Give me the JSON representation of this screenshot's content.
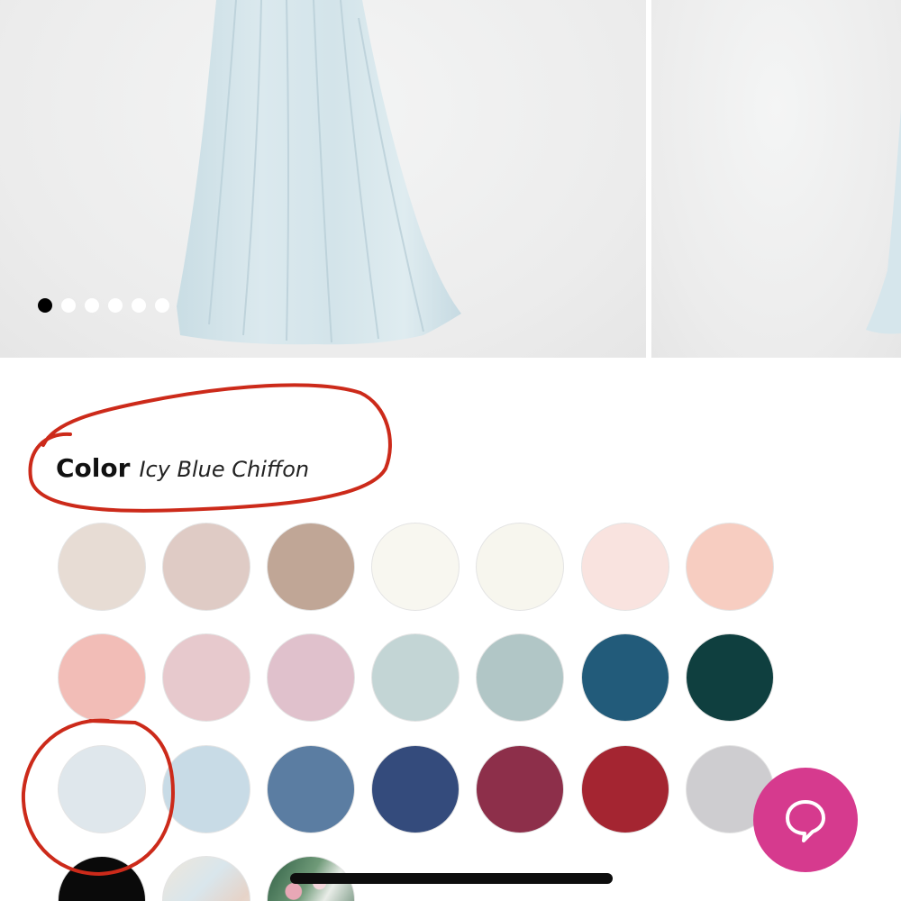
{
  "gallery": {
    "dots_total": 6,
    "active_index": 0
  },
  "color": {
    "label": "Color",
    "selected": "Icy Blue Chiffon"
  },
  "swatches": [
    {
      "name": "swatch-1",
      "color": "#e7dcd4"
    },
    {
      "name": "swatch-2",
      "color": "#dfcbc5"
    },
    {
      "name": "swatch-3",
      "color": "#c0a696"
    },
    {
      "name": "swatch-4",
      "color": "#f8f7f0"
    },
    {
      "name": "swatch-5",
      "color": "#f7f6ee"
    },
    {
      "name": "swatch-6",
      "color": "#f9e3df"
    },
    {
      "name": "swatch-7",
      "color": "#f7cdc1"
    },
    {
      "name": "swatch-8",
      "color": "#f2bdb7"
    },
    {
      "name": "swatch-9",
      "color": "#e7c9cd"
    },
    {
      "name": "swatch-10",
      "color": "#e0c1cc"
    },
    {
      "name": "swatch-11",
      "color": "#c3d5d5"
    },
    {
      "name": "swatch-12",
      "color": "#b1c6c6"
    },
    {
      "name": "swatch-13",
      "color": "#225b7a"
    },
    {
      "name": "swatch-14",
      "color": "#0f3f3f"
    },
    {
      "name": "swatch-icy-blue",
      "color": "#dfe7ec"
    },
    {
      "name": "swatch-16",
      "color": "#c8dbe6"
    },
    {
      "name": "swatch-17",
      "color": "#5b7da2"
    },
    {
      "name": "swatch-18",
      "color": "#344b7c"
    },
    {
      "name": "swatch-19",
      "color": "#8d2f4a"
    },
    {
      "name": "swatch-20",
      "color": "#a42531"
    },
    {
      "name": "swatch-21",
      "color": "#cecdd0"
    },
    {
      "name": "swatch-22",
      "color": "#0a0a0a"
    },
    {
      "name": "swatch-23-print",
      "color": "#e5ddd1"
    },
    {
      "name": "swatch-24-print",
      "color": "#3f6b4f"
    }
  ],
  "annotation_color": "#cc2a1a",
  "chat": {
    "icon": "chat-bubble-icon",
    "color": "#d63a8e"
  }
}
